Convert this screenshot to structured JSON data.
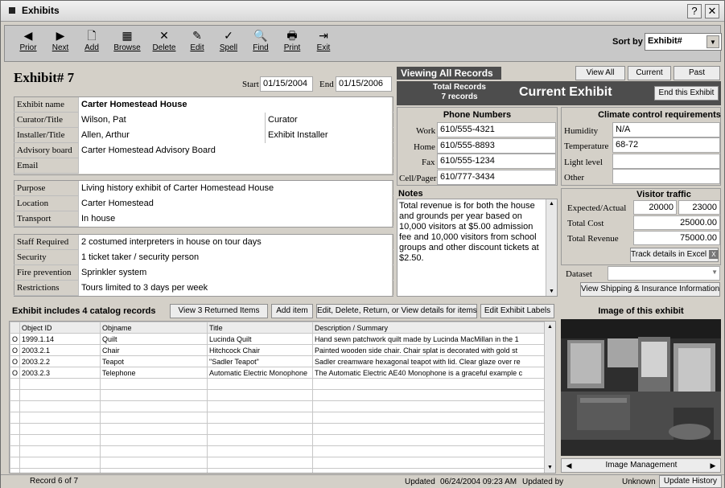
{
  "window": {
    "title": "Exhibits",
    "help_btn": "?",
    "close_btn": "✕"
  },
  "toolbar": {
    "buttons": [
      {
        "label": "Prior",
        "icon": "◀"
      },
      {
        "label": "Next",
        "icon": "▶"
      },
      {
        "label": "Add",
        "icon": "🗋"
      },
      {
        "label": "Browse",
        "icon": "▦"
      },
      {
        "label": "Delete",
        "icon": "✕"
      },
      {
        "label": "Edit",
        "icon": "✎"
      },
      {
        "label": "Spell",
        "icon": "✓"
      },
      {
        "label": "Find",
        "icon": "🔍"
      },
      {
        "label": "Print",
        "icon": "🖶"
      },
      {
        "label": "Exit",
        "icon": "⇥"
      }
    ],
    "sort_label": "Sort by",
    "sort_value": "Exhibit#"
  },
  "header": {
    "exhibit_label": "Exhibit#",
    "exhibit_no": "7",
    "start_label": "Start",
    "start_value": "01/15/2004",
    "end_label": "End",
    "end_value": "01/15/2006"
  },
  "details": {
    "exhibit_name": {
      "label": "Exhibit name",
      "value": "Carter Homestead House"
    },
    "curator": {
      "label": "Curator/Title",
      "value": "Wilson, Pat",
      "title": "Curator"
    },
    "installer": {
      "label": "Installer/Title",
      "value": "Allen, Arthur",
      "title": "Exhibit Installer"
    },
    "advisory": {
      "label": "Advisory board",
      "value": "Carter Homestead Advisory Board"
    },
    "email": {
      "label": "Email",
      "value": ""
    },
    "purpose": {
      "label": "Purpose",
      "value": "Living history exhibit of Carter Homestead House"
    },
    "location": {
      "label": "Location",
      "value": "Carter Homestead"
    },
    "transport": {
      "label": "Transport",
      "value": "In house"
    },
    "staff": {
      "label": "Staff Required",
      "value": "2 costumed interpreters in house on tour days"
    },
    "security": {
      "label": "Security",
      "value": "1 ticket taker / security person"
    },
    "fire": {
      "label": "Fire prevention",
      "value": "Sprinkler system"
    },
    "restrictions": {
      "label": "Restrictions",
      "value": "Tours limited to 3 days per week"
    }
  },
  "records": {
    "viewing": "Viewing All Records",
    "view_all": "View All",
    "current": "Current",
    "past": "Past",
    "total_label": "Total Records",
    "total_value": "7 records",
    "current_exhibit": "Current Exhibit",
    "end_exhibit": "End this Exhibit"
  },
  "phones": {
    "title": "Phone Numbers",
    "work_label": "Work",
    "work": "610/555-4321",
    "home_label": "Home",
    "home": "610/555-8893",
    "fax_label": "Fax",
    "fax": "610/555-1234",
    "cell_label": "Cell/Pager",
    "cell": "610/777-3434"
  },
  "climate": {
    "title": "Climate control requirements",
    "humidity_label": "Humidity",
    "humidity": "N/A",
    "temp_label": "Temperature",
    "temp": "68-72",
    "light_label": "Light level",
    "light": "",
    "other_label": "Other",
    "other": ""
  },
  "notes": {
    "label": "Notes",
    "text": "Total revenue is for both the house and grounds per year based on 10,000 visitors at $5.00 admission fee and 10,000 visitors from  school groups and other discount tickets at $2.50."
  },
  "traffic": {
    "title": "Visitor traffic",
    "expected_label": "Expected/Actual",
    "expected": "20000",
    "actual": "23000",
    "cost_label": "Total Cost",
    "cost": "25000.00",
    "revenue_label": "Total Revenue",
    "revenue": "75000.00",
    "excel_btn": "Track details in Excel",
    "dataset_label": "Dataset",
    "dataset": "",
    "shipping_btn": "View Shipping & Insurance Information"
  },
  "catalog": {
    "title": "Exhibit includes 4 catalog records",
    "view_returned": "View 3 Returned Items",
    "add_item": "Add item",
    "edit_btn": "Edit, Delete, Return, or View details for items",
    "labels_btn": "Edit Exhibit Labels",
    "columns": [
      "Object ID",
      "Objname",
      "Title",
      "Description / Summary"
    ],
    "rows": [
      [
        "1999.1.14",
        "Quilt",
        "Lucinda Quilt",
        "Hand sewn patchwork quilt made by Lucinda MacMillan in the  1"
      ],
      [
        "2003.2.1",
        "Chair",
        "Hitchcock Chair",
        "Painted wooden side chair. Chair splat is decorated with gold  st"
      ],
      [
        "2003.2.2",
        "Teapot",
        "\"Sadler Teapot\"",
        "Sadler creamware hexagonal teapot with lid. Clear glaze over re"
      ],
      [
        "2003.2.3",
        "Telephone",
        "Automatic Electric Monophone",
        "The Automatic Electric AE40 Monophone is a graceful example c"
      ]
    ]
  },
  "image": {
    "title": "Image of this exhibit",
    "manage": "Image Management"
  },
  "status": {
    "record": "Record 6 of 7",
    "updated_label": "Updated",
    "updated": "06/24/2004 09:23 AM",
    "updated_by_label": "Updated by",
    "updated_by": "Unknown",
    "history_btn": "Update History"
  }
}
